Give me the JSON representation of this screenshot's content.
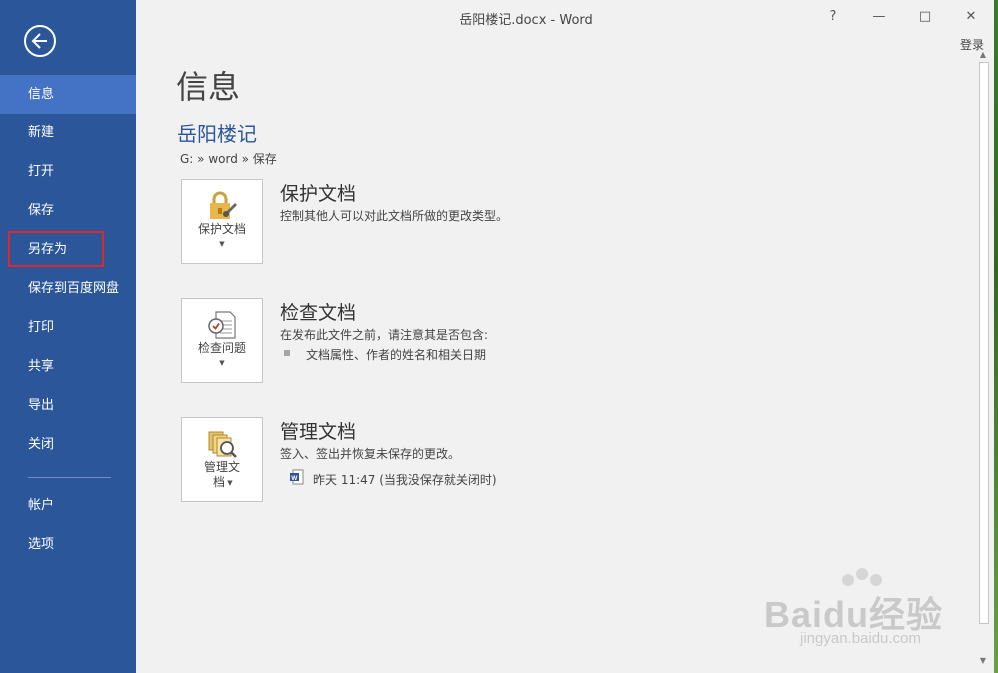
{
  "window": {
    "title": "岳阳楼记.docx - Word",
    "help_label": "?",
    "minimize_label": "—",
    "maximize_label": "□",
    "close_label": "✕",
    "login_label": "登录"
  },
  "sidebar": {
    "back_icon": "back-arrow-icon",
    "items": [
      {
        "label": "信息",
        "active": true
      },
      {
        "label": "新建"
      },
      {
        "label": "打开"
      },
      {
        "label": "保存"
      },
      {
        "label": "另存为",
        "highlighted": true
      },
      {
        "label": "保存到百度网盘"
      },
      {
        "label": "打印"
      },
      {
        "label": "共享"
      },
      {
        "label": "导出"
      },
      {
        "label": "关闭"
      },
      {
        "label": "帐户"
      },
      {
        "label": "选项"
      }
    ]
  },
  "main": {
    "page_title": "信息",
    "doc_title": "岳阳楼记",
    "doc_path": "G: » word » 保存",
    "sections": [
      {
        "tile_label": "保护文档",
        "icon": "lock-key-icon",
        "title": "保护文档",
        "description": "控制其他人可以对此文档所做的更改类型。"
      },
      {
        "tile_label": "检查问题",
        "icon": "inspect-document-icon",
        "title": "检查文档",
        "description": "在发布此文件之前，请注意其是否包含:",
        "items": [
          "文档属性、作者的姓名和相关日期"
        ]
      },
      {
        "tile_label_line1": "管理文",
        "tile_label_line2": "档",
        "icon": "manage-versions-icon",
        "title": "管理文档",
        "description": "签入、签出并恢复未保存的更改。",
        "version": "昨天 11:47 (当我没保存就关闭时)"
      }
    ]
  },
  "watermark": {
    "brand": "Baidu经验",
    "url": "jingyan.baidu.com"
  },
  "colors": {
    "sidebar": "#2b579a",
    "sidebar_active": "#4472c4",
    "highlight_box": "#e3262d",
    "doc_title": "#2b579a",
    "content_bg": "#f1f1f1"
  }
}
